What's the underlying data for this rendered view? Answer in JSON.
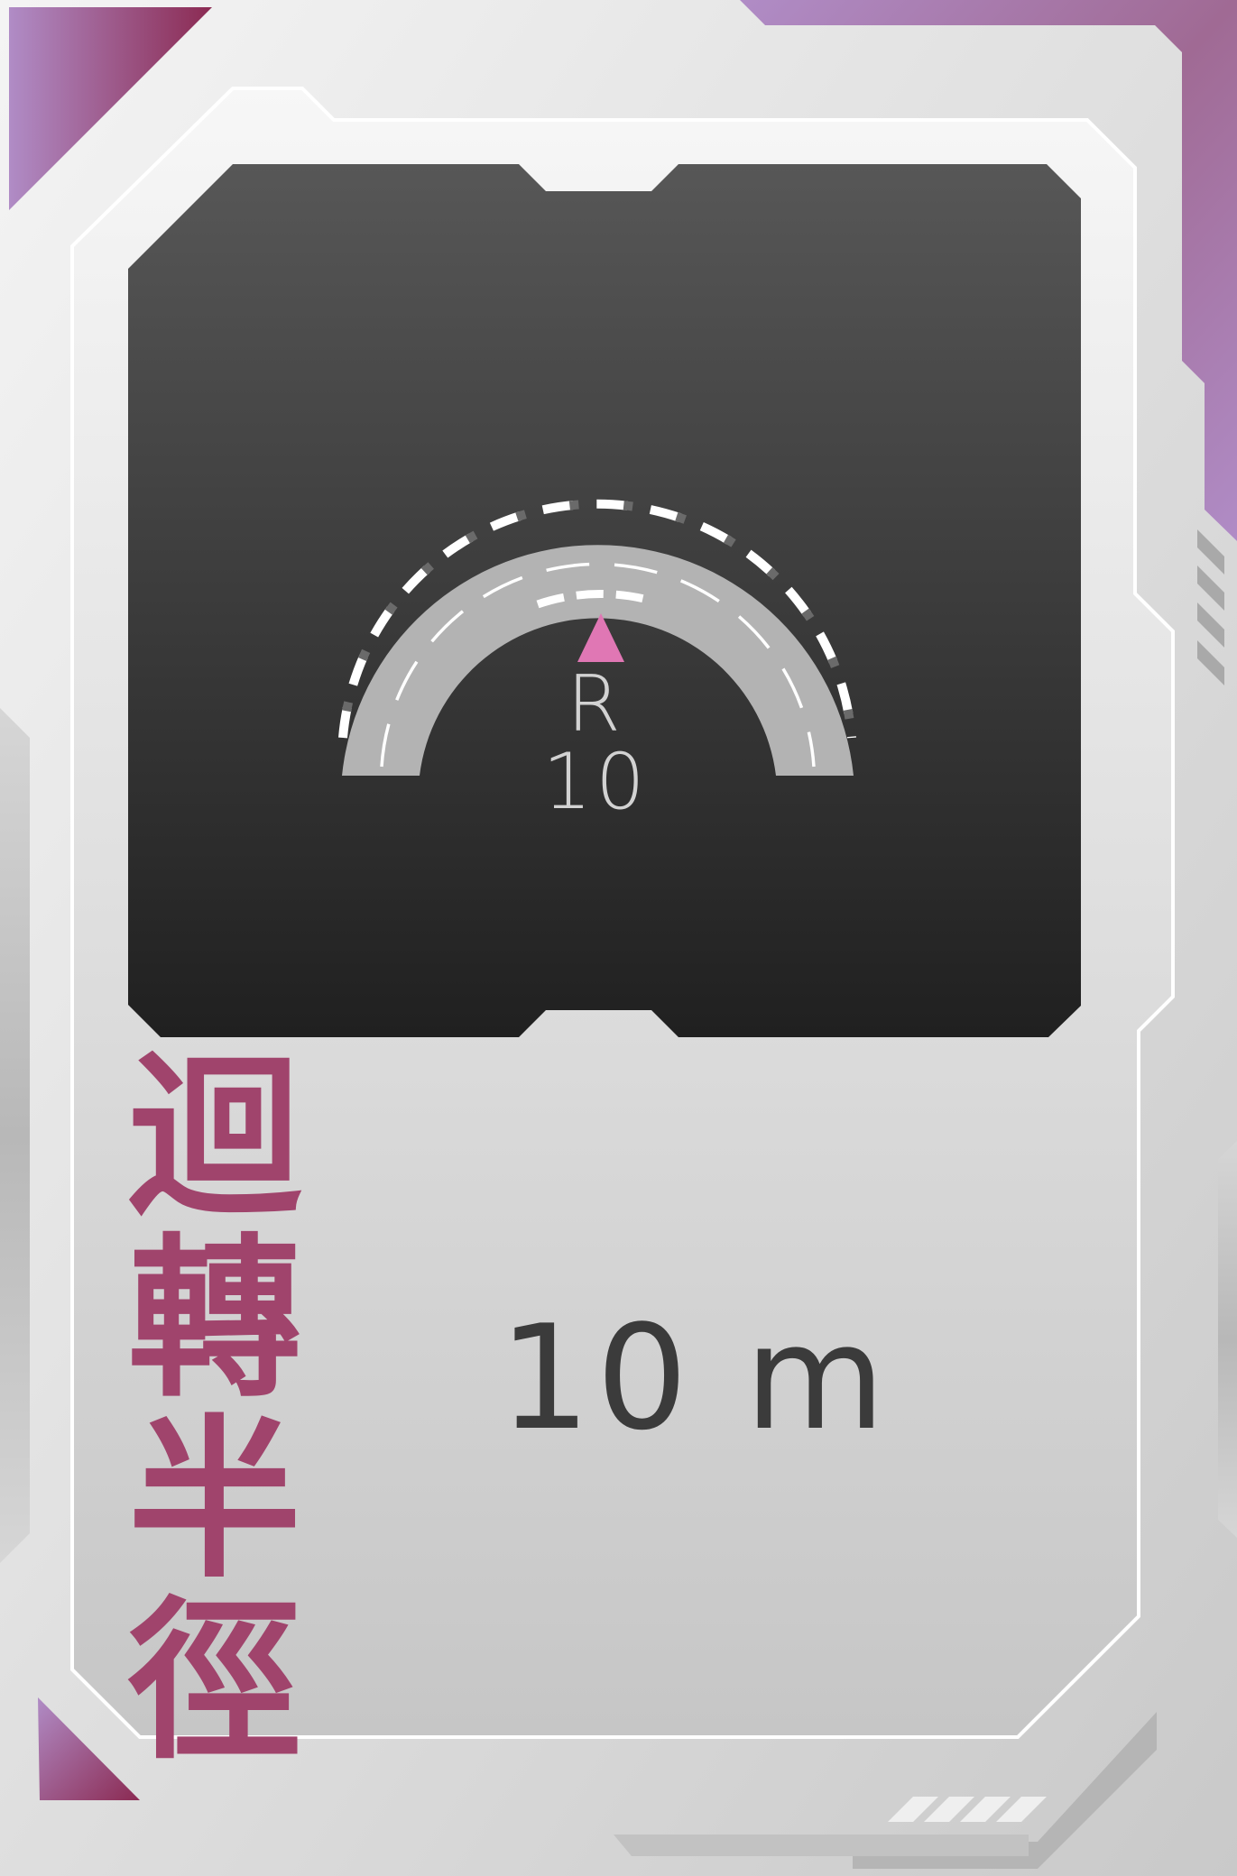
{
  "card": {
    "title_chars": [
      "迴",
      "轉",
      "半",
      "徑"
    ],
    "value": "10 m",
    "display": {
      "radius_label": "R 10",
      "icon": "curved-road-icon",
      "marker_icon": "triangle-marker-icon"
    }
  },
  "colors": {
    "accent_magenta": "#a0446c",
    "accent_purple": "#b08cc6",
    "marker_pink": "#e077b4",
    "screen_top": "#575757",
    "screen_bottom": "#202020",
    "road_gray": "#b3b3b3"
  }
}
